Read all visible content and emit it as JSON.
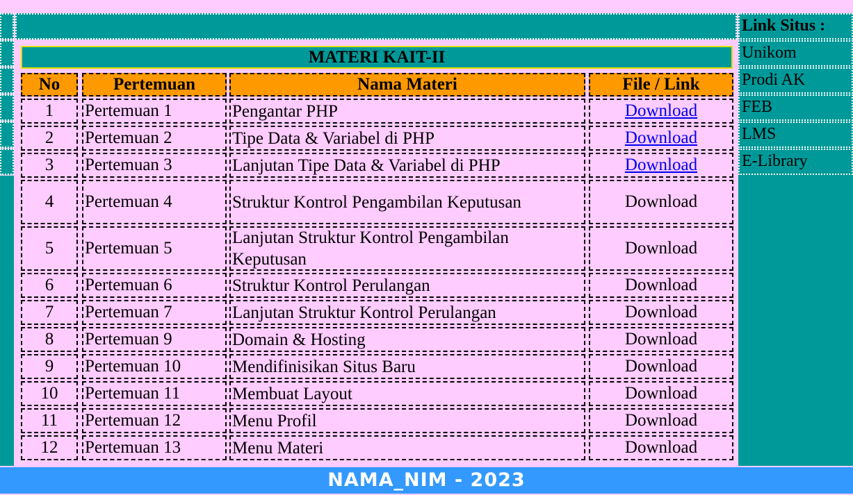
{
  "materi": {
    "title": "MATERI KAIT-II",
    "headers": {
      "no": "No",
      "pertemuan": "Pertemuan",
      "nama": "Nama Materi",
      "file": "File / Link"
    },
    "rows": [
      {
        "no": "1",
        "pertemuan": "Pertemuan 1",
        "nama": "Pengantar PHP",
        "file": "Download",
        "linked": true
      },
      {
        "no": "2",
        "pertemuan": "Pertemuan 2",
        "nama": "Tipe Data & Variabel di PHP",
        "file": "Download",
        "linked": true
      },
      {
        "no": "3",
        "pertemuan": "Pertemuan 3",
        "nama": "Lanjutan Tipe Data & Variabel di PHP",
        "file": "Download",
        "linked": true
      },
      {
        "no": "4",
        "pertemuan": "Pertemuan 4",
        "nama": "Struktur Kontrol Pengambilan Keputusan",
        "file": "Download",
        "linked": false
      },
      {
        "no": "5",
        "pertemuan": "Pertemuan 5",
        "nama": "Lanjutan Struktur Kontrol Pengambilan Keputusan",
        "file": "Download",
        "linked": false
      },
      {
        "no": "6",
        "pertemuan": "Pertemuan 6",
        "nama": "Struktur Kontrol Perulangan",
        "file": "Download",
        "linked": false
      },
      {
        "no": "7",
        "pertemuan": "Pertemuan 7",
        "nama": "Lanjutan Struktur Kontrol Perulangan",
        "file": "Download",
        "linked": false
      },
      {
        "no": "8",
        "pertemuan": "Pertemuan 9",
        "nama": "Domain & Hosting",
        "file": "Download",
        "linked": false
      },
      {
        "no": "9",
        "pertemuan": "Pertemuan 10",
        "nama": "Mendifinisikan Situs Baru",
        "file": "Download",
        "linked": false
      },
      {
        "no": "10",
        "pertemuan": "Pertemuan 11",
        "nama": "Membuat Layout",
        "file": "Download",
        "linked": false
      },
      {
        "no": "11",
        "pertemuan": "Pertemuan 12",
        "nama": "Menu Profil",
        "file": "Download",
        "linked": false
      },
      {
        "no": "12",
        "pertemuan": "Pertemuan 13",
        "nama": "Menu Materi",
        "file": "Download",
        "linked": false
      }
    ]
  },
  "links": {
    "title": "Link Situs :",
    "items": [
      "Unikom",
      "Prodi AK",
      "FEB",
      "LMS",
      "E-Library"
    ]
  },
  "footer": {
    "text": "NAMA_NIM - 2023"
  },
  "colors": {
    "teal": "#009999",
    "pink": "#ffccff",
    "orange": "#ff9900",
    "footer_blue": "#3399ff",
    "link_blue": "#0000ee"
  }
}
